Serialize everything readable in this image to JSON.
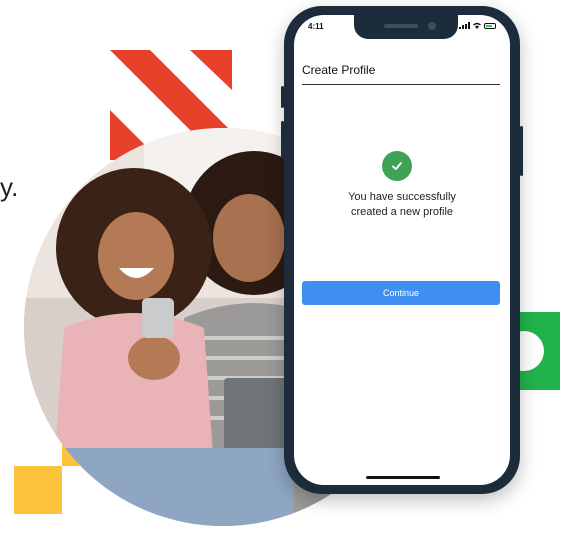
{
  "marketing": {
    "fragment_text": "y."
  },
  "colors": {
    "red_stripes": "#e8412b",
    "green_block": "#22b24c",
    "yellow_squares": "#fbc43c",
    "phone_frame": "#1d2c3a",
    "success_green": "#3ea355",
    "button_blue": "#3f8ff0"
  },
  "phone": {
    "status_bar": {
      "time": "4:11"
    },
    "header": {
      "title": "Create Profile"
    },
    "success": {
      "icon": "checkmark-icon",
      "line1": "You have successfully",
      "line2": "created a new profile"
    },
    "continue_label": "Continue"
  }
}
